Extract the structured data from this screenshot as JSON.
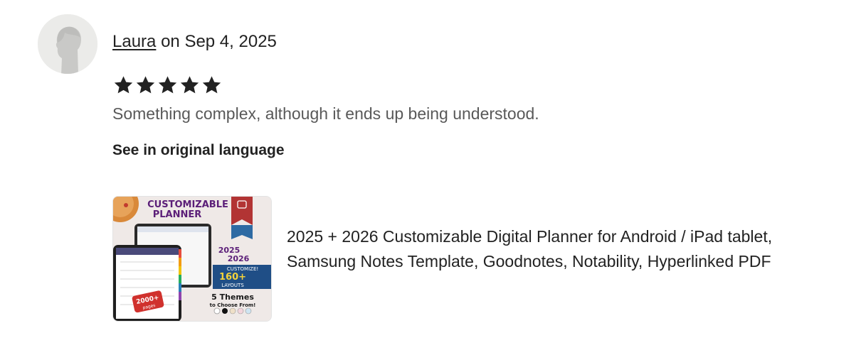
{
  "review": {
    "reviewer_name": "Laura",
    "date_prefix": "on",
    "date": "Sep 4, 2025",
    "rating": 5,
    "max_rating": 5,
    "text": "Something complex, although it ends up being understood.",
    "see_original_label": "See in original language"
  },
  "listing": {
    "title": "2025 + 2026 Customizable Digital Planner for Android / iPad tablet, Samsung Notes Template, Goodnotes, Notability, Hyperlinked PDF",
    "thumbnail": {
      "heading_line1": "CUSTOMIZABLE",
      "heading_line2": "PLANNER",
      "years_line1": "2025",
      "years_line2": "2026",
      "customize_label": "CUSTOMIZE!",
      "layouts_count": "160+",
      "layouts_label": "LAYOUTS",
      "pages_count": "2000+",
      "pages_label": "pages",
      "themes_line1": "5 Themes",
      "themes_line2": "to Choose From!"
    }
  },
  "colors": {
    "star": "#222222",
    "text_primary": "#222222",
    "text_secondary": "#595959",
    "thumb_purple": "#5b1e78",
    "thumb_blue": "#1f4e86",
    "thumb_red": "#d0312d"
  }
}
